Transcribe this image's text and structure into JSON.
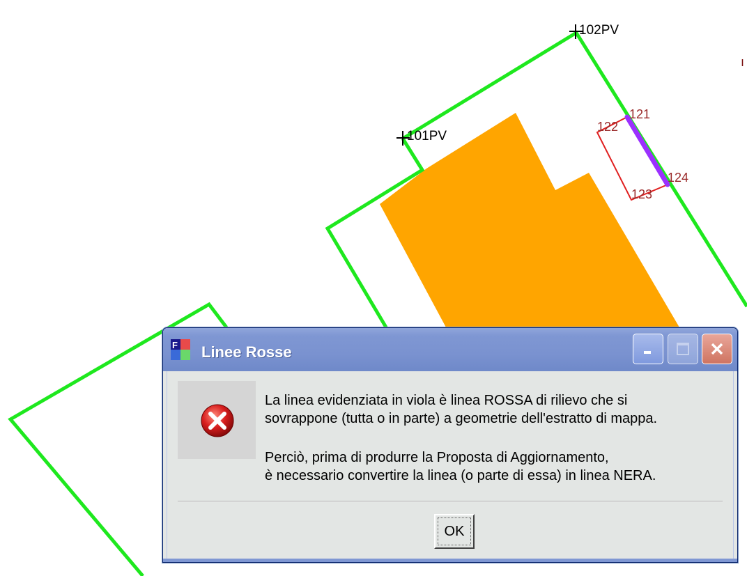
{
  "map": {
    "labels": {
      "point_102": "102PV",
      "point_101": "101PV",
      "point_121": "121",
      "point_122": "122",
      "point_123": "123",
      "point_124": "124"
    },
    "colors": {
      "parcel_outline": "#1ee81e",
      "building_fill": "#ffa500",
      "red_line": "#e02020",
      "highlight_line": "#9b30ff"
    }
  },
  "dialog": {
    "title": "Linee Rosse",
    "title_icon": "fortran-app-icon",
    "message_icon": "error-icon",
    "message_lines": [
      "La linea evidenziata in viola è linea ROSSA di rilievo che si",
      "sovrappone (tutta o in parte) a geometrie dell'estratto di mappa.",
      "Perciò, prima di produrre la Proposta di Aggiornamento,",
      "è necessario convertire la linea (o parte di essa) in linea NERA."
    ],
    "ok_label": "OK",
    "titlebar_buttons": [
      "minimize",
      "maximize",
      "close"
    ]
  }
}
